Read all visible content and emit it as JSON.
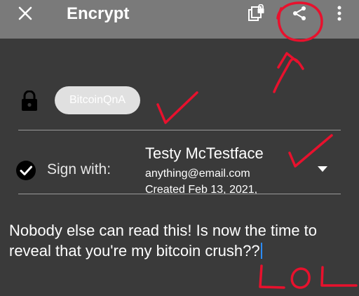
{
  "toolbar": {
    "title": "Encrypt",
    "icons": {
      "close": "close-icon",
      "encrypt_copy": "lock-copy-icon",
      "share": "share-icon",
      "overflow": "more-vert-icon"
    }
  },
  "recipient": {
    "chip_label": "BitcoinQnA",
    "icon": "lock-icon"
  },
  "sign": {
    "label": "Sign with:",
    "key_name": "Testy McTestface",
    "key_email": "anything@email.com",
    "key_created": "Created Feb 13, 2021,"
  },
  "message": {
    "text": "Nobody else can read this! Is now the time to reveal that you're my bitcoin crush??"
  },
  "annotations": {
    "note": "LOL"
  },
  "colors": {
    "toolbar": "#7a7a7a",
    "background": "#3a3a3a",
    "chip": "#e0e0e0",
    "cursor": "#2b8cff",
    "annotation": "#e8112d"
  }
}
